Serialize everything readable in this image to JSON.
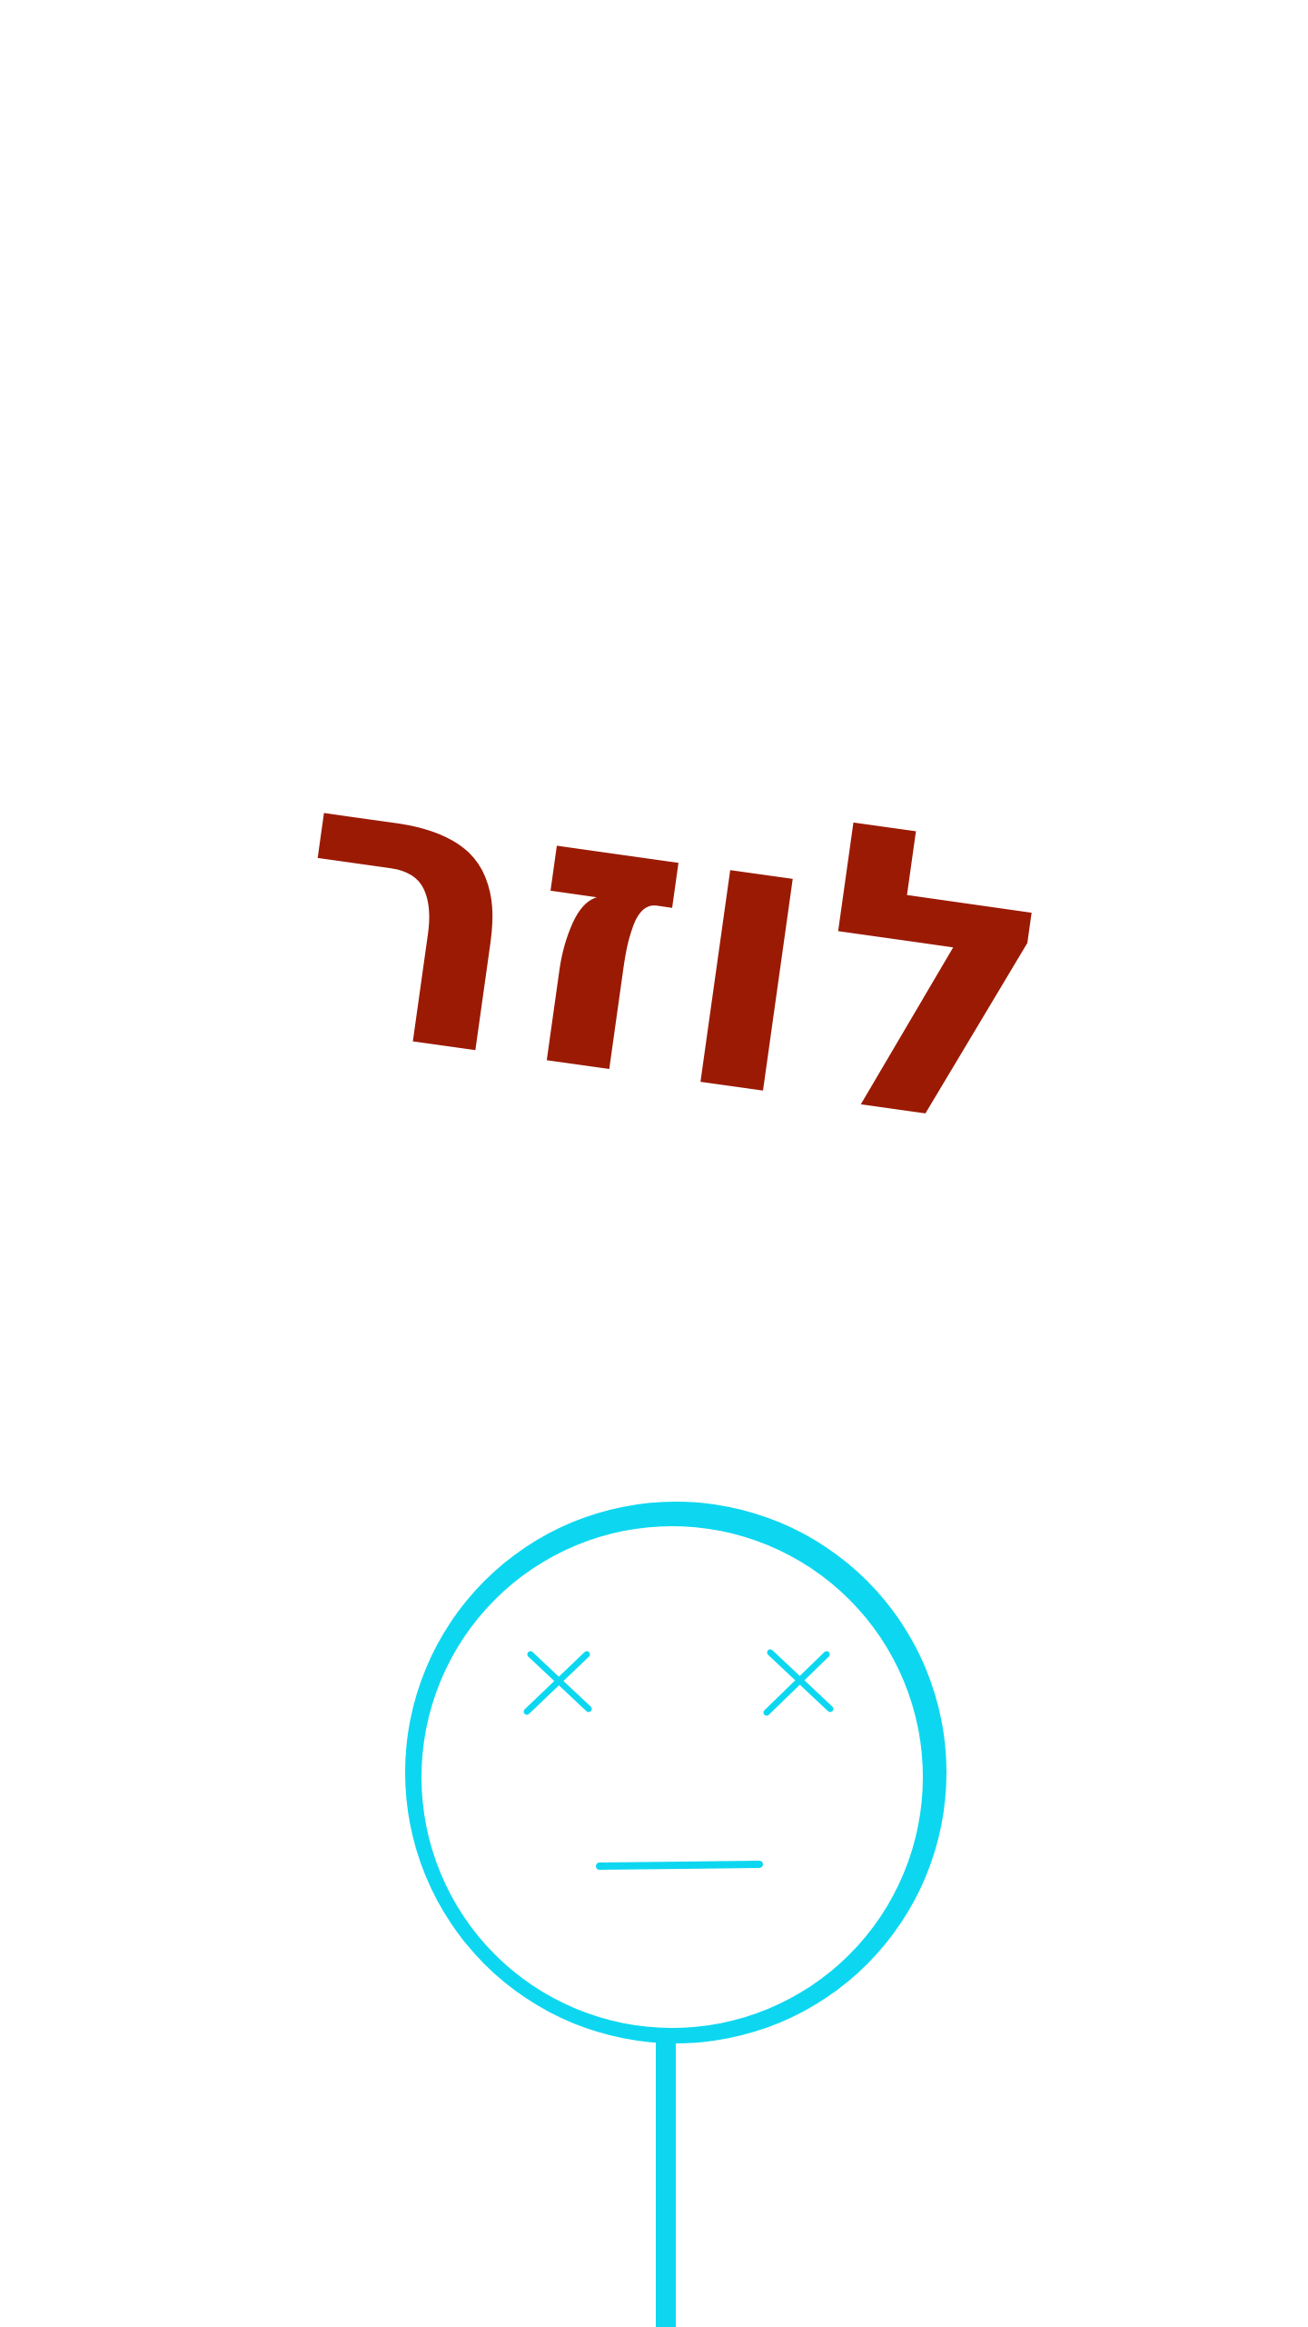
{
  "result": {
    "title": "לוזר",
    "title_color": "#9b1a04"
  },
  "character": {
    "state": "dead",
    "face_icon": "dizzy-face-icon",
    "color": "#0dd7f0"
  }
}
